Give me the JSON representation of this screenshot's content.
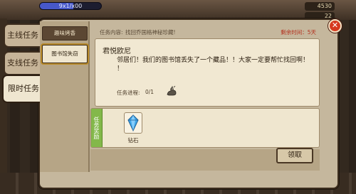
{
  "hud": {
    "hp_text": "9x1/x00",
    "hp_fraction": 0.55,
    "coin_top": "4530",
    "coin_second": "22"
  },
  "side_tabs": {
    "main": "主线任务",
    "branch": "支线任务",
    "limited": "限时任务"
  },
  "categories": {
    "item_1": "趣味烤香",
    "item_2": "图书馆失窃"
  },
  "header": {
    "content_label": "任务内容:",
    "content_value": "找回乔国格神秘珍藏!",
    "time": "剩余时间：5天"
  },
  "quest": {
    "npc_name": "君悦欧尼",
    "dialog": "邻居们！我们的图书馆丢失了一个藏品！！大家一定要帮忙找回啊！",
    "dialog_second_line": "！",
    "progress_label": "任务进程:",
    "progress_value": "0/1",
    "progress_icon": "dragon-figurine-icon"
  },
  "reward": {
    "label": "任务奖励",
    "item_icon": "diamond-icon",
    "item_name": "钻石"
  },
  "buttons": {
    "claim": "领取",
    "close": "✕"
  },
  "colors": {
    "close_red": "#d63a1f",
    "reward_green": "#83b84a",
    "time_red": "#b32d1a",
    "hp_blue": "#4758c9"
  }
}
